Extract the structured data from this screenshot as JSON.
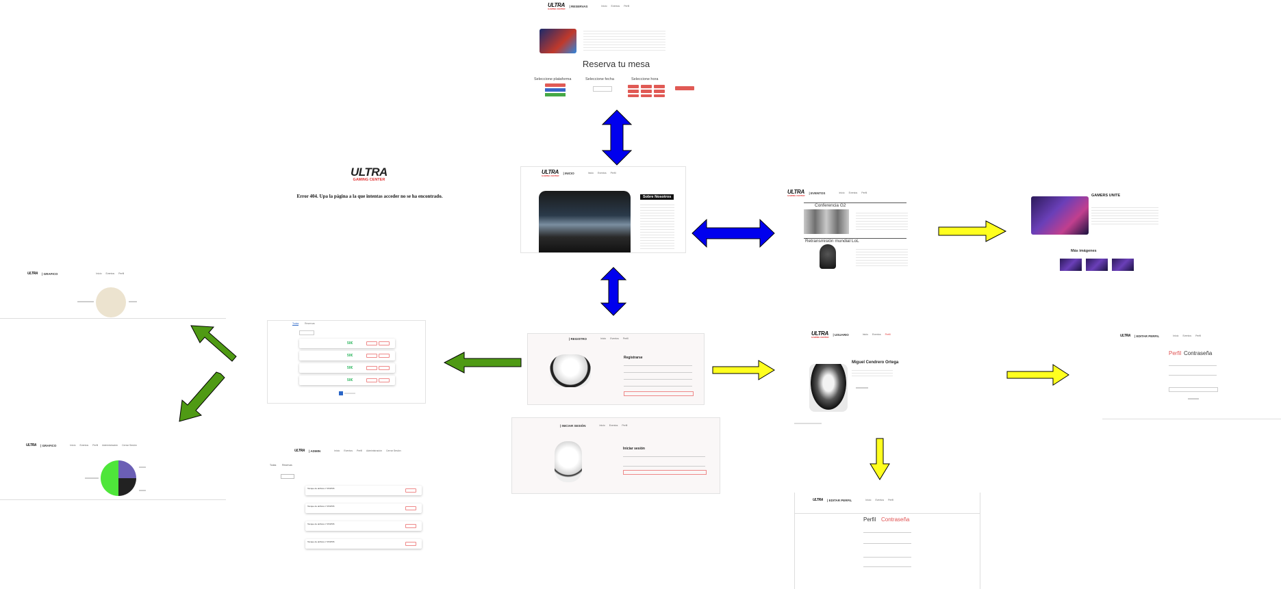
{
  "colors": {
    "blue_arrow": "#0000ee",
    "green_arrow": "#4f9a14",
    "yellow_arrow": "#ffff1f",
    "brand_red": "#e03131"
  },
  "brand": {
    "logo": "ULTRA",
    "tagline": "GAMING CENTER"
  },
  "nav_links": {
    "inicio": "Inicio",
    "eventos": "Eventos",
    "perfil": "Perfil"
  },
  "screens": {
    "reservas": {
      "section": "| RESERVAS",
      "heading": "Reserva tu mesa",
      "platform_label": "Seleccione plataforma",
      "date_label": "Seleccione fecha",
      "time_label": "Seleccione hora"
    },
    "error404": {
      "message": "Error 404. Upa la página a la que intentas acceder no se ha encontrado."
    },
    "inicio": {
      "section": "| INICIO",
      "about_title": "Sobre Nosotros"
    },
    "eventos": {
      "section": "| EVENTOS",
      "event1": "Conferencia G2",
      "event2": "Retransmisión mundial LoL"
    },
    "evento_detalle": {
      "title": "GAMERS UNITE",
      "more_images": "Más imágenes"
    },
    "grafico_top": {
      "section": "| GRAFICO"
    },
    "grafico_bottom": {
      "section": "| GRAFICO",
      "links": [
        "Inicio",
        "Eventos",
        "Perfil",
        "Administración",
        "Cerrar Sesión"
      ]
    },
    "reservas_list": {
      "tabs": [
        "Todas",
        "Reservas"
      ],
      "prices": [
        "50€",
        "50€",
        "50€",
        "50€"
      ]
    },
    "admin": {
      "section": "| ADMIN",
      "items": [
        "Tanque de atributo n°15/3/5/6",
        "Tanque de atributo n°15/3/5/6",
        "Tanque de atributo n°15/3/5/6",
        "Tanque de atributo n°15/3/5/6"
      ]
    },
    "registro": {
      "section": "| REGISTRO",
      "form_title": "Registrarse"
    },
    "login": {
      "section": "| INICIAR SESIÓN",
      "form_title": "Iniciar sesión"
    },
    "perfil": {
      "section": "| USUARIO",
      "name": "Miguel Cendrero Ortega"
    },
    "editar_perfil_right": {
      "section": "| EDITAR PERFIL",
      "tab_perfil": "Perfil",
      "tab_password": "Contraseña"
    },
    "editar_perfil_bottom": {
      "section": "| EDITAR PERFIL",
      "tab_perfil": "Perfil",
      "tab_password": "Contraseña"
    }
  }
}
